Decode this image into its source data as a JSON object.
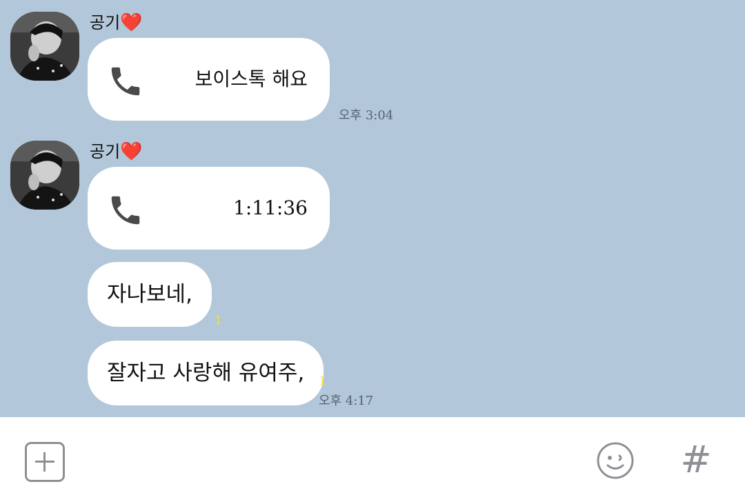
{
  "colors": {
    "chat_background": "#b2c7da",
    "bubble": "#ffffff",
    "unread_count": "#f2e23a",
    "icon_gray": "#8d8f94"
  },
  "messages": [
    {
      "sender": "공기",
      "sender_emoji": "❤️",
      "type": "voice-call",
      "icon": "phone-icon",
      "text": "보이스톡 해요",
      "time": "오후 3:04"
    },
    {
      "sender": "공기",
      "sender_emoji": "❤️",
      "type": "voice-call",
      "icon": "phone-icon",
      "text": "1:11:36"
    },
    {
      "type": "text",
      "text": "자나보네,",
      "unread": "1"
    },
    {
      "type": "text",
      "text": "잘자고 사랑해 유여주,",
      "unread": "1",
      "time": "오후 4:17"
    }
  ],
  "input_bar": {
    "plus_icon": "plus-square-icon",
    "emoji_icon": "smiley-icon",
    "hash_label": "#"
  }
}
